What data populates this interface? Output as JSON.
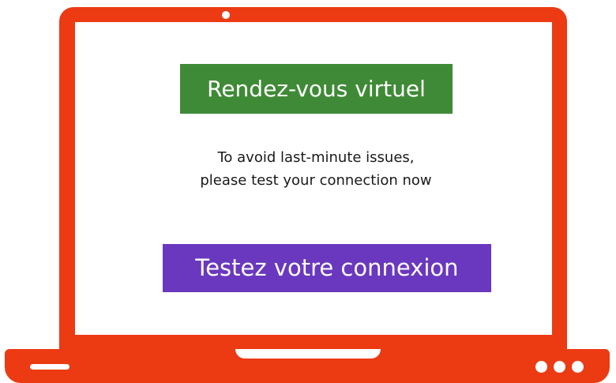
{
  "screen": {
    "title": "Rendez-vous virtuel",
    "message_line1": "To avoid last-minute issues,",
    "message_line2": "please test your connection now",
    "button_label": "Testez votre connexion"
  },
  "colors": {
    "laptop_frame": "#ec3a13",
    "title_background": "#3f8a36",
    "button_background": "#6a38be",
    "screen_background": "#ffffff"
  },
  "icons": {
    "webcam": "webcam-dot-icon",
    "base_indicator_dots": "three-dots-icon"
  }
}
